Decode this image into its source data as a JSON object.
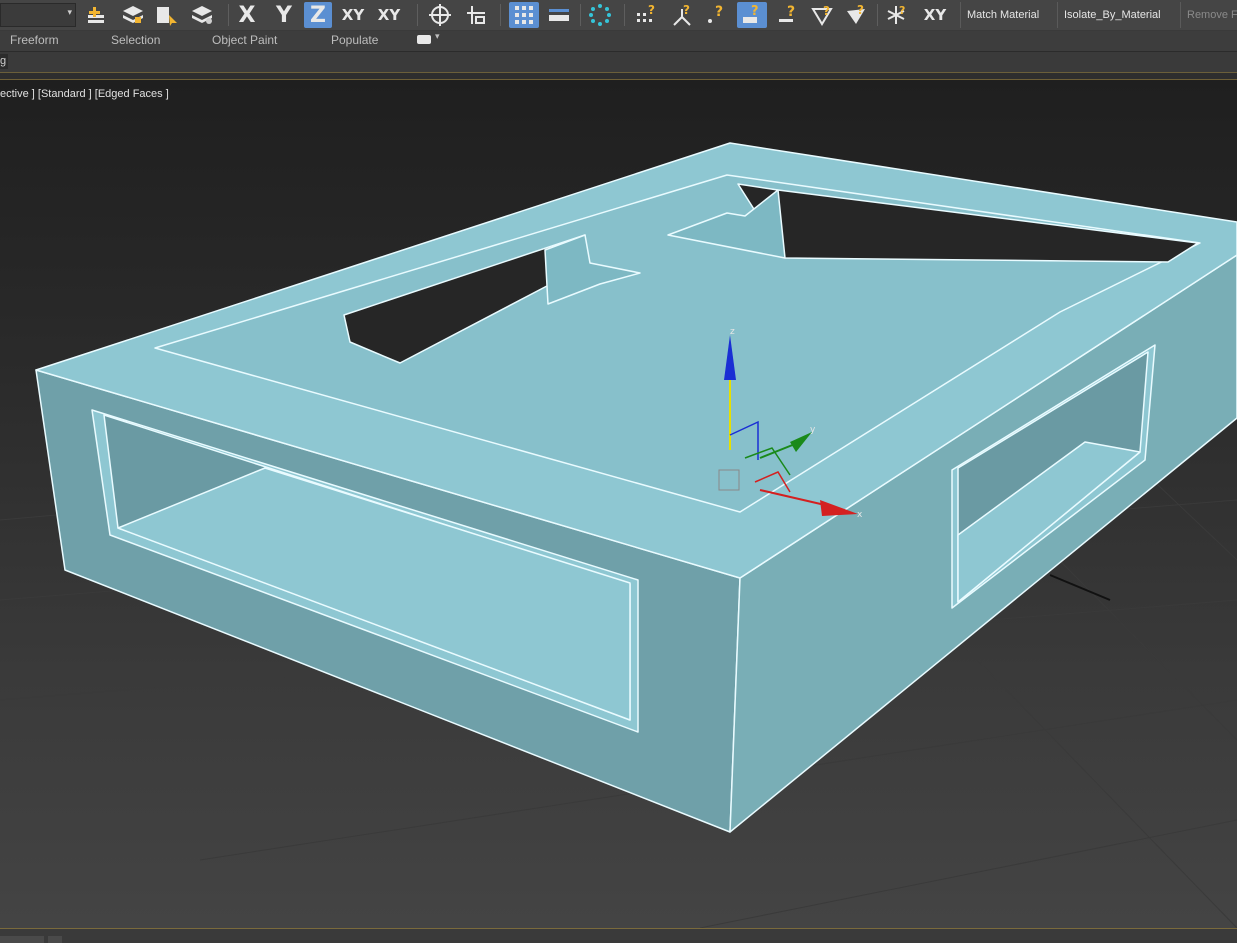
{
  "toolbar": {
    "axis": {
      "x": "X",
      "y": "Y",
      "z": "Z",
      "xy": "XY",
      "xy_cycle": "XY"
    },
    "custom_buttons": [
      "Match Material",
      "Isolate_By_Material",
      "Remove F"
    ]
  },
  "ribbon": {
    "tabs": [
      "Freeform",
      "Selection",
      "Object Paint",
      "Populate"
    ]
  },
  "subbar": {
    "field_text": "g"
  },
  "viewport": {
    "label": "ective ] [Standard ] [Edged Faces ]",
    "model_color": "#8ec7d2",
    "gizmo": {
      "x_label": "x",
      "y_label": "y",
      "z_label": "z",
      "x_color": "#d42020",
      "y_color": "#1a8a1a",
      "z_color": "#1a2fd4"
    }
  },
  "colors": {
    "accent": "#5b8fd2",
    "icon_gold": "#f2b531"
  }
}
